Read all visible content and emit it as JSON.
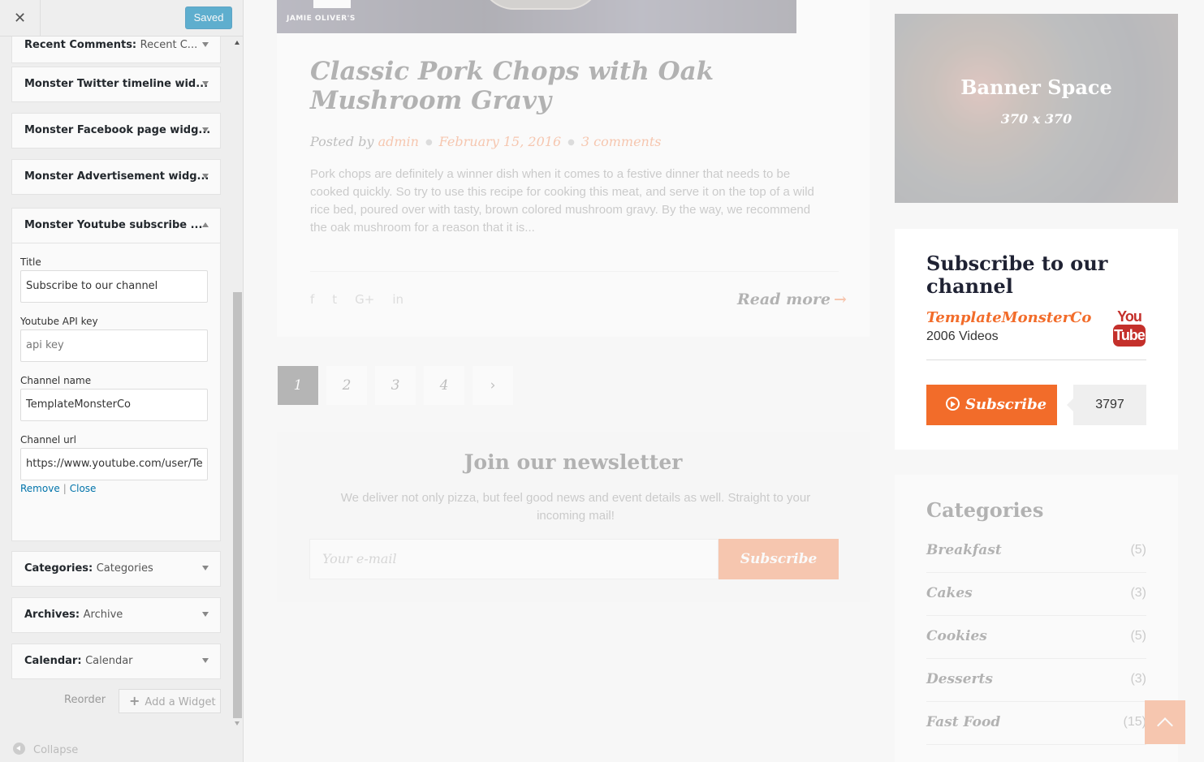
{
  "customizer": {
    "close_glyph": "✕",
    "saved_label": "Saved",
    "widgets_top": [
      {
        "title": "Recent Comments:",
        "subtitle": "Recent C..."
      },
      {
        "title": "Monster Twitter timeline wid...",
        "subtitle": ""
      },
      {
        "title": "Monster Facebook page widg...",
        "subtitle": ""
      },
      {
        "title": "Monster Advertisement widg...",
        "subtitle": ""
      }
    ],
    "open_widget": {
      "title": "Monster Youtube subscribe ...",
      "fields": {
        "title_label": "Title",
        "title_value": "Subscribe to our channel",
        "api_label": "Youtube API key",
        "api_placeholder": "api key",
        "channel_label": "Channel name",
        "channel_value": "TemplateMonsterCo",
        "url_label": "Channel url",
        "url_value": "https://www.youtube.com/user/Te"
      },
      "remove_label": "Remove",
      "separator": "|",
      "close_label": "Close"
    },
    "widgets_bottom": [
      {
        "title": "Categories:",
        "subtitle": "Categories"
      },
      {
        "title": "Archives:",
        "subtitle": "Archive"
      },
      {
        "title": "Calendar:",
        "subtitle": "Calendar"
      }
    ],
    "reorder_label": "Reorder",
    "add_widget_label": "Add a Widget",
    "collapse_label": "Collapse"
  },
  "preview": {
    "post": {
      "image_caption": "JAMIE OLIVER'S",
      "title": "Classic Pork Chops with Oak Mushroom Gravy",
      "posted_by": "Posted by",
      "author": "admin",
      "date": "February 15, 2016",
      "comments": "3 comments",
      "excerpt": "Pork chops are definitely a winner dish when it comes to a festive dinner that needs to be cooked quickly. So try to use this recipe for cooking this meat, and serve it on the top of a wild rice bed, poured over with tasty, brown colored mushroom gravy. By the way, we recommend the oak mushroom for a reason that it is...",
      "share_icons": [
        "f",
        "t",
        "G+",
        "in"
      ],
      "read_more": "Read more",
      "read_more_arrow": "→"
    },
    "pagination": {
      "pages": [
        "1",
        "2",
        "3",
        "4"
      ],
      "next": "›",
      "current": "1"
    },
    "newsletter": {
      "title": "Join our newsletter",
      "text": "We deliver not only pizza, but feel good news and event details as well. Straight to your incoming mail!",
      "placeholder": "Your e-mail",
      "button": "Subscribe"
    },
    "banner": {
      "title": "Banner Space",
      "size": "370 x 370"
    },
    "youtube_widget": {
      "title": "Subscribe to our channel",
      "channel": "TemplateMonsterCo",
      "videos": "2006 Videos",
      "logo_top": "You",
      "logo_bottom": "Tube",
      "subscribe": "Subscribe",
      "count": "3797"
    },
    "categories": {
      "title": "Categories",
      "items": [
        {
          "name": "Breakfast",
          "count": "(5)"
        },
        {
          "name": "Cakes",
          "count": "(3)"
        },
        {
          "name": "Cookies",
          "count": "(5)"
        },
        {
          "name": "Desserts",
          "count": "(3)"
        },
        {
          "name": "Fast Food",
          "count": "(15)"
        }
      ]
    },
    "colors": {
      "accent": "#f26c2a",
      "wp_blue": "#0073aa",
      "youtube_red": "#c4302b"
    }
  }
}
